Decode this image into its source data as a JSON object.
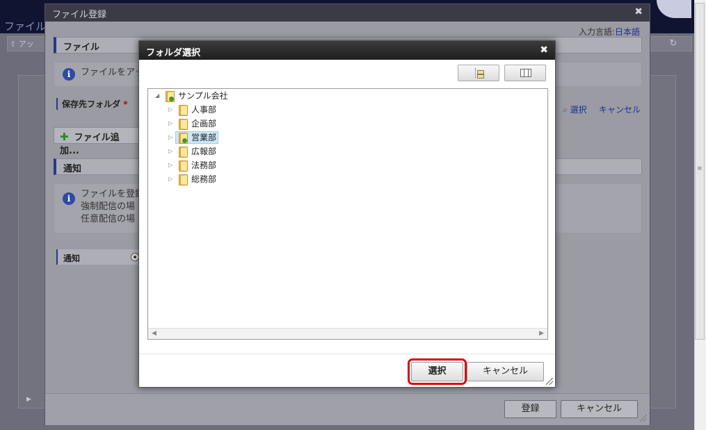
{
  "background": {
    "header_title": "ファイル",
    "up_button": "アッ"
  },
  "file_dialog": {
    "title": "ファイル登録",
    "lang_label": "入力言語:",
    "lang_value": "日本語",
    "file_section": "ファイル",
    "file_info": "ファイルをアッ",
    "folder_label": "保存先フォルダ",
    "required_mark": "*",
    "select_link": "選択",
    "cancel_link": "キャンセル",
    "add_file_button": "ファイル追加...",
    "notify_section": "通知",
    "notify_info_lines": [
      "ファイルを登録",
      "強制配信の場",
      "任意配信の場"
    ],
    "notify_label": "通知",
    "register_button": "登録",
    "cancel_button": "キャンセル"
  },
  "folder_dialog": {
    "title": "フォルダ選択",
    "tree": {
      "root": "サンプル会社",
      "children": [
        {
          "label": "人事部",
          "selected": false
        },
        {
          "label": "企画部",
          "selected": false
        },
        {
          "label": "営業部",
          "selected": true
        },
        {
          "label": "広報部",
          "selected": false
        },
        {
          "label": "法務部",
          "selected": false
        },
        {
          "label": "総務部",
          "selected": false
        }
      ]
    },
    "select_button": "選択",
    "cancel_button": "キャンセル"
  },
  "icons": {
    "close": "close-icon",
    "tree_view": "tree-view-icon",
    "column_view": "column-view-icon",
    "info": "info-icon",
    "folder": "folder-icon"
  },
  "colors": {
    "highlight_outline": "#e00000",
    "selected_node": "#cde8f8",
    "link": "#1b2f8f"
  }
}
